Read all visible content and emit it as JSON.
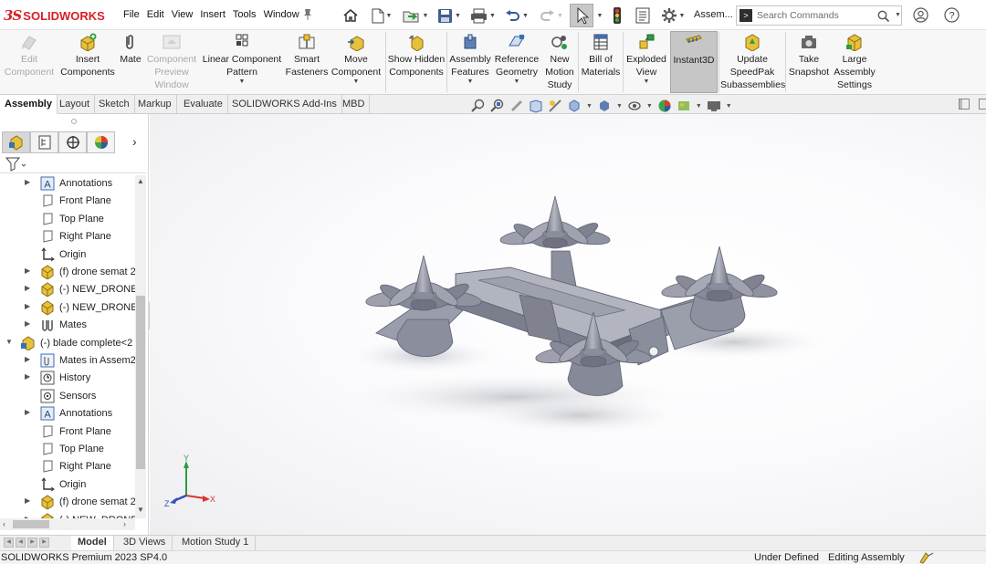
{
  "app": {
    "logo_mark": "3S",
    "logo_text": "SOLIDWORKS",
    "document_name": "Assem...",
    "product_version": "SOLIDWORKS Premium 2023 SP4.0"
  },
  "menu": [
    "File",
    "Edit",
    "View",
    "Insert",
    "Tools",
    "Window"
  ],
  "search": {
    "placeholder": "Search Commands"
  },
  "quick_access_icons": [
    "home-icon",
    "new-document-icon",
    "open-icon",
    "save-icon",
    "print-icon",
    "undo-icon",
    "redo-icon",
    "select-icon",
    "rebuild-icon",
    "file-properties-icon",
    "options-icon"
  ],
  "commands": [
    {
      "label": "Edit Component",
      "disabled": true
    },
    {
      "label": "Insert Components",
      "disabled": false
    },
    {
      "label": "Mate",
      "disabled": false
    },
    {
      "label": "Component Preview Window",
      "disabled": true
    },
    {
      "label": "Linear Component Pattern",
      "disabled": false
    },
    {
      "label": "Smart Fasteners",
      "disabled": false
    },
    {
      "label": "Move Component",
      "disabled": false
    },
    {
      "label": "Show Hidden Components",
      "disabled": false
    },
    {
      "label": "Assembly Features",
      "disabled": false
    },
    {
      "label": "Reference Geometry",
      "disabled": false
    },
    {
      "label": "New Motion Study",
      "disabled": false
    },
    {
      "label": "Bill of Materials",
      "disabled": false
    },
    {
      "label": "Exploded View",
      "disabled": false
    },
    {
      "label": "Instant3D",
      "disabled": false,
      "active": true
    },
    {
      "label": "Update SpeedPak Subassemblies",
      "disabled": false
    },
    {
      "label": "Take Snapshot",
      "disabled": false
    },
    {
      "label": "Large Assembly Settings",
      "disabled": false
    }
  ],
  "tabs": [
    "Assembly",
    "Layout",
    "Sketch",
    "Markup",
    "Evaluate",
    "SOLIDWORKS Add-Ins",
    "MBD"
  ],
  "active_tab": "Assembly",
  "feature_tree": [
    {
      "label": "Annotations",
      "icon": "annotations-icon",
      "expandable": true,
      "expanded": false,
      "level": 1
    },
    {
      "label": "Front Plane",
      "icon": "plane-icon",
      "expandable": false,
      "level": 1
    },
    {
      "label": "Top Plane",
      "icon": "plane-icon",
      "expandable": false,
      "level": 1
    },
    {
      "label": "Right Plane",
      "icon": "plane-icon",
      "expandable": false,
      "level": 1
    },
    {
      "label": "Origin",
      "icon": "origin-icon",
      "expandable": false,
      "level": 1
    },
    {
      "label": "(f) drone semat 2",
      "icon": "part-icon",
      "expandable": true,
      "expanded": false,
      "level": 1
    },
    {
      "label": "(-) NEW_DRONE_",
      "icon": "part-icon",
      "expandable": true,
      "expanded": false,
      "level": 1
    },
    {
      "label": "(-) NEW_DRONE_",
      "icon": "part-icon",
      "expandable": true,
      "expanded": false,
      "level": 1
    },
    {
      "label": "Mates",
      "icon": "mates-icon",
      "expandable": true,
      "expanded": false,
      "level": 1
    },
    {
      "label": "(-) blade complete<2",
      "icon": "assembly-icon",
      "expandable": true,
      "expanded": true,
      "level": 0
    },
    {
      "label": "Mates in Assem2",
      "icon": "mates-folder-icon",
      "expandable": true,
      "expanded": false,
      "level": 1
    },
    {
      "label": "History",
      "icon": "history-icon",
      "expandable": true,
      "expanded": false,
      "level": 1
    },
    {
      "label": "Sensors",
      "icon": "sensors-icon",
      "expandable": false,
      "level": 1
    },
    {
      "label": "Annotations",
      "icon": "annotations-icon",
      "expandable": true,
      "expanded": false,
      "level": 1
    },
    {
      "label": "Front Plane",
      "icon": "plane-icon",
      "expandable": false,
      "level": 1
    },
    {
      "label": "Top Plane",
      "icon": "plane-icon",
      "expandable": false,
      "level": 1
    },
    {
      "label": "Right Plane",
      "icon": "plane-icon",
      "expandable": false,
      "level": 1
    },
    {
      "label": "Origin",
      "icon": "origin-icon",
      "expandable": false,
      "level": 1
    },
    {
      "label": "(f) drone semat 2",
      "icon": "part-icon",
      "expandable": true,
      "expanded": false,
      "level": 1
    },
    {
      "label": "(-) NEW_DRONE_",
      "icon": "part-icon",
      "expandable": true,
      "expanded": false,
      "level": 1
    }
  ],
  "triad": {
    "x": "X",
    "y": "Y",
    "z": "Z"
  },
  "model_colors": {
    "body": "#8e91a0",
    "shadow": "#5f6270",
    "highlight": "#c7c9d3"
  },
  "bottom_tabs": [
    "Model",
    "3D Views",
    "Motion Study 1"
  ],
  "active_bottom_tab": "Model",
  "status": {
    "state": "Under Defined",
    "mode": "Editing Assembly"
  }
}
